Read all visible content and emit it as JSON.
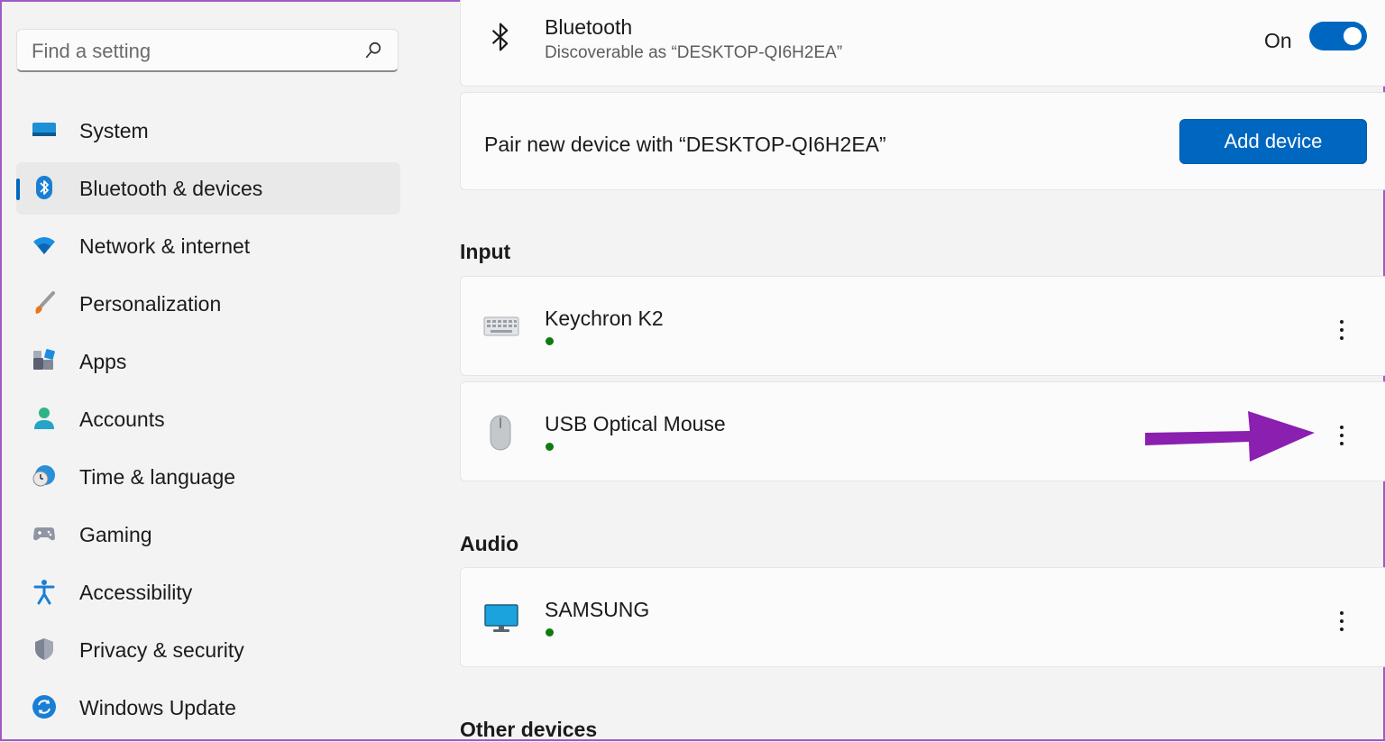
{
  "search": {
    "placeholder": "Find a setting",
    "icon": "search-icon"
  },
  "sidebar": {
    "items": [
      {
        "label": "System",
        "icon": "system-icon"
      },
      {
        "label": "Bluetooth & devices",
        "icon": "bluetooth-icon",
        "active": true
      },
      {
        "label": "Network & internet",
        "icon": "wifi-icon"
      },
      {
        "label": "Personalization",
        "icon": "brush-icon"
      },
      {
        "label": "Apps",
        "icon": "apps-icon"
      },
      {
        "label": "Accounts",
        "icon": "person-icon"
      },
      {
        "label": "Time & language",
        "icon": "globe-clock-icon"
      },
      {
        "label": "Gaming",
        "icon": "gamepad-icon"
      },
      {
        "label": "Accessibility",
        "icon": "accessibility-icon"
      },
      {
        "label": "Privacy & security",
        "icon": "shield-icon"
      },
      {
        "label": "Windows Update",
        "icon": "update-icon"
      }
    ]
  },
  "bluetooth": {
    "title": "Bluetooth",
    "subtitle": "Discoverable as “DESKTOP-QI6H2EA”",
    "state_label": "On",
    "enabled": true
  },
  "pair": {
    "text": "Pair new device with “DESKTOP-QI6H2EA”",
    "button_label": "Add device"
  },
  "sections": {
    "input": "Input",
    "audio": "Audio",
    "other": "Other devices"
  },
  "devices": {
    "keyboard": {
      "name": "Keychron K2",
      "icon": "keyboard-icon",
      "connected": true
    },
    "mouse": {
      "name": "USB Optical Mouse",
      "icon": "mouse-icon",
      "connected": true
    },
    "samsung": {
      "name": "SAMSUNG",
      "icon": "monitor-icon",
      "connected": true
    }
  },
  "colors": {
    "accent": "#0067c0",
    "connected": "#0f7b0f",
    "annotation_arrow": "#8a1fb0"
  }
}
